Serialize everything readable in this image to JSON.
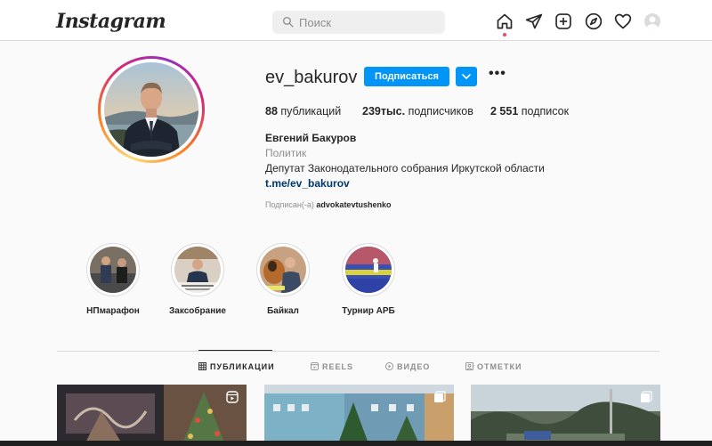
{
  "header": {
    "logo_text": "Instagram",
    "search_placeholder": "Поиск",
    "icons": [
      "home-icon",
      "direct-icon",
      "new-post-icon",
      "explore-icon",
      "activity-icon",
      "profile-avatar"
    ]
  },
  "profile": {
    "username": "ev_bakurov",
    "follow_label": "Подписаться",
    "more_label": "•••",
    "stats": {
      "posts_count": "88",
      "posts_label": "публикаций",
      "followers_count": "239тыс.",
      "followers_label": "подписчиков",
      "following_count": "2 551",
      "following_label": "подписок"
    },
    "full_name": "Евгений Бакуров",
    "category": "Политик",
    "bio": "Депутат Законодательного собрания Иркутской области",
    "link": "t.me/ev_bakurov",
    "followed_by_prefix": "Подписан(-а)",
    "followed_by_user": "advokatevtushenko"
  },
  "highlights": [
    {
      "label": "НПмарафон"
    },
    {
      "label": "Заксобрание"
    },
    {
      "label": "Байкал"
    },
    {
      "label": "Турнир АРБ"
    }
  ],
  "tabs": [
    {
      "label": "ПУБЛИКАЦИИ",
      "active": true
    },
    {
      "label": "REELS",
      "active": false
    },
    {
      "label": "ВИДЕО",
      "active": false
    },
    {
      "label": "ОТМЕТКИ",
      "active": false
    }
  ],
  "colors": {
    "accent": "#0095f6",
    "link": "#00376b",
    "notification_dot": "#ed4956"
  }
}
